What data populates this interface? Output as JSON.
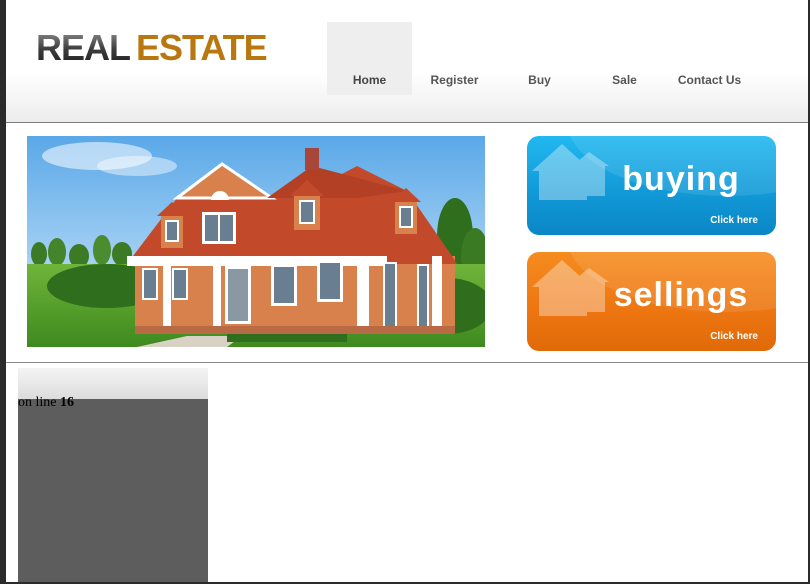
{
  "logo": {
    "word1": "REAL",
    "word2": "ESTATE"
  },
  "nav": [
    {
      "label": "Home",
      "active": true
    },
    {
      "label": "Register",
      "active": false
    },
    {
      "label": "Buy",
      "active": false
    },
    {
      "label": "Sale",
      "active": false
    },
    {
      "label": "Contact Us",
      "active": false
    }
  ],
  "promos": {
    "buying": {
      "title": "buying",
      "link": "Click here",
      "color": "#129ad8"
    },
    "selling": {
      "title": "sellings",
      "link": "Click here",
      "color": "#ee7712"
    }
  },
  "sidebar": {
    "error_prefix": "on line",
    "error_line": "16"
  },
  "colors": {
    "logo_accent": "#b8780f",
    "sidebar_box": "#5d5d5d"
  }
}
